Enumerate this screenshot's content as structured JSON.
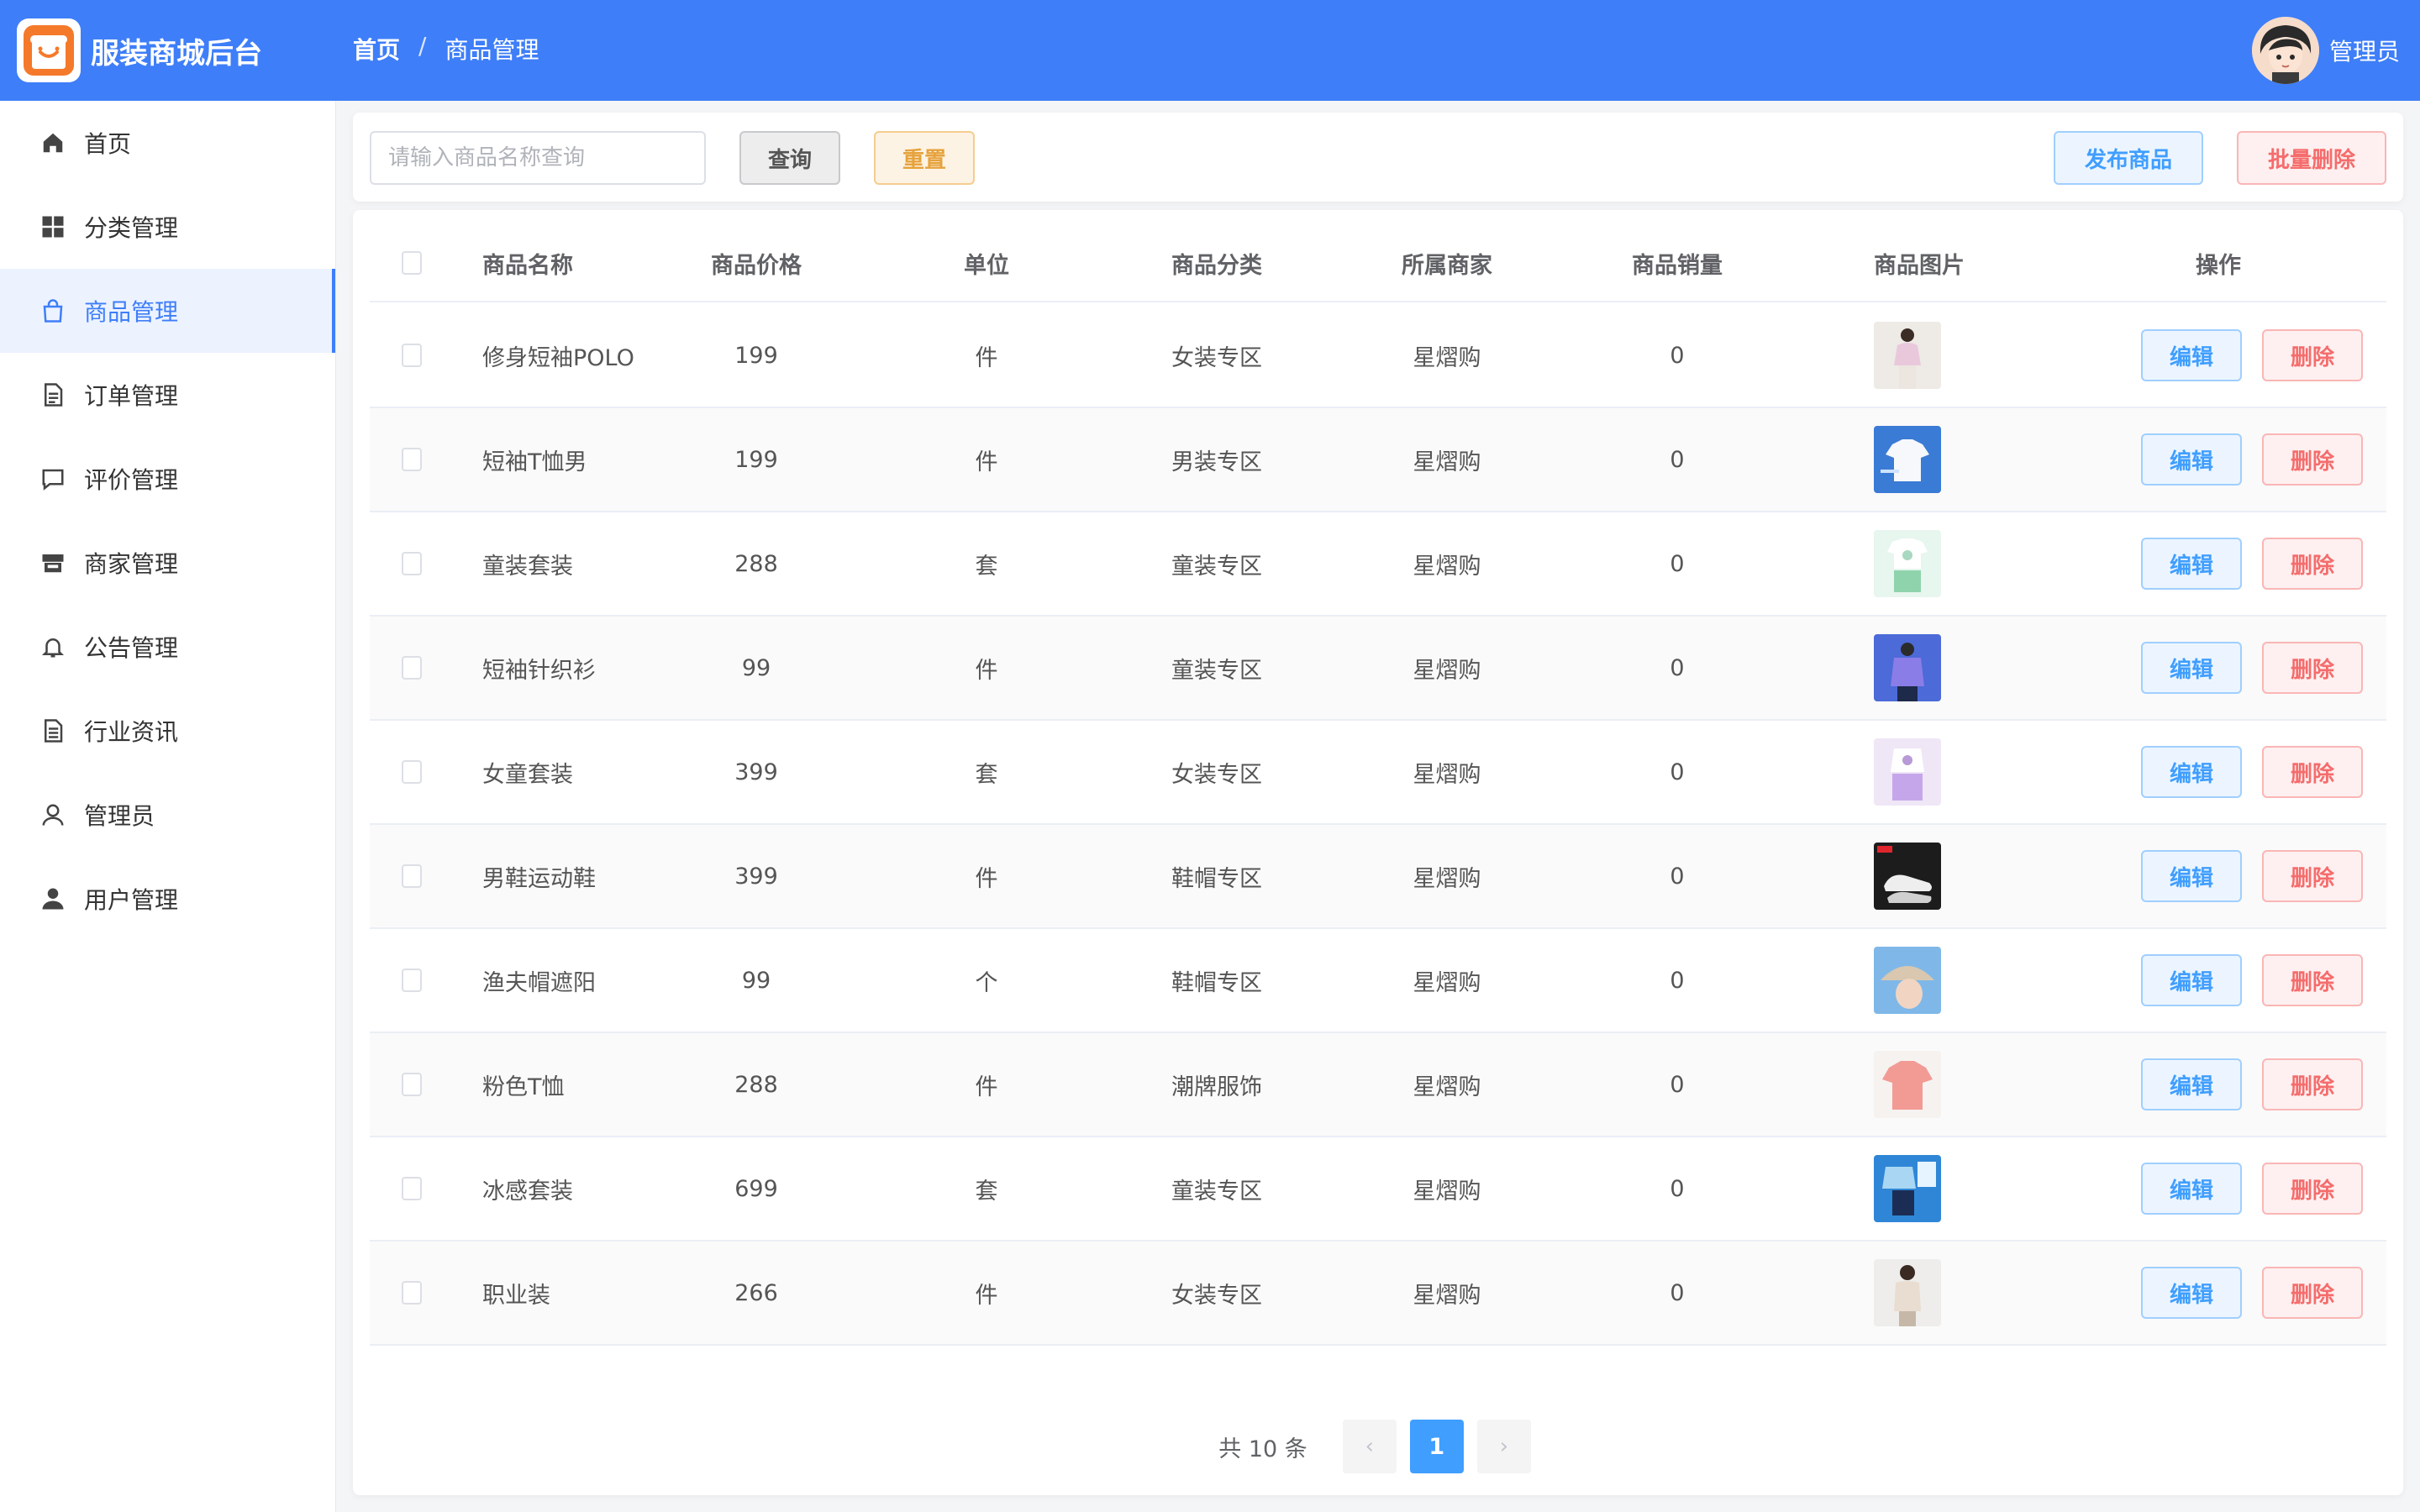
{
  "header": {
    "app_title": "服装商城后台",
    "breadcrumb": {
      "home": "首页",
      "separator": "/",
      "current": "商品管理"
    },
    "user_name": "管理员",
    "bg_color": "#3e7ef8"
  },
  "sidebar": {
    "items": [
      {
        "label": "首页",
        "icon": "home-icon",
        "active": false
      },
      {
        "label": "分类管理",
        "icon": "grid-icon",
        "active": false
      },
      {
        "label": "商品管理",
        "icon": "bag-icon",
        "active": true
      },
      {
        "label": "订单管理",
        "icon": "document-icon",
        "active": false
      },
      {
        "label": "评价管理",
        "icon": "chat-icon",
        "active": false
      },
      {
        "label": "商家管理",
        "icon": "shop-icon",
        "active": false
      },
      {
        "label": "公告管理",
        "icon": "bell-icon",
        "active": false
      },
      {
        "label": "行业资讯",
        "icon": "news-icon",
        "active": false
      },
      {
        "label": "管理员",
        "icon": "user-outline-icon",
        "active": false
      },
      {
        "label": "用户管理",
        "icon": "user-filled-icon",
        "active": false
      }
    ]
  },
  "search": {
    "placeholder": "请输入商品名称查询",
    "value": "",
    "query_label": "查询",
    "reset_label": "重置",
    "publish_label": "发布商品",
    "batch_delete_label": "批量删除"
  },
  "table": {
    "columns": [
      "商品名称",
      "商品价格",
      "单位",
      "商品分类",
      "所属商家",
      "商品销量",
      "商品图片",
      "操作"
    ],
    "edit_label": "编辑",
    "delete_label": "删除",
    "rows": [
      {
        "name": "修身短袖POLO",
        "price": "199",
        "unit": "件",
        "category": "女装专区",
        "merchant": "星熠购",
        "sales": "0",
        "thumb": "woman-polo"
      },
      {
        "name": "短袖T恤男",
        "price": "199",
        "unit": "件",
        "category": "男装专区",
        "merchant": "星熠购",
        "sales": "0",
        "thumb": "white-tee"
      },
      {
        "name": "童装套装",
        "price": "288",
        "unit": "套",
        "category": "童装专区",
        "merchant": "星熠购",
        "sales": "0",
        "thumb": "kids-set"
      },
      {
        "name": "短袖针织衫",
        "price": "99",
        "unit": "件",
        "category": "童装专区",
        "merchant": "星熠购",
        "sales": "0",
        "thumb": "purple-knit"
      },
      {
        "name": "女童套装",
        "price": "399",
        "unit": "套",
        "category": "女装专区",
        "merchant": "星熠购",
        "sales": "0",
        "thumb": "girl-set"
      },
      {
        "name": "男鞋运动鞋",
        "price": "399",
        "unit": "件",
        "category": "鞋帽专区",
        "merchant": "星熠购",
        "sales": "0",
        "thumb": "sneakers"
      },
      {
        "name": "渔夫帽遮阳",
        "price": "99",
        "unit": "个",
        "category": "鞋帽专区",
        "merchant": "星熠购",
        "sales": "0",
        "thumb": "bucket-hat"
      },
      {
        "name": "粉色T恤",
        "price": "288",
        "unit": "件",
        "category": "潮牌服饰",
        "merchant": "星熠购",
        "sales": "0",
        "thumb": "pink-tee"
      },
      {
        "name": "冰感套装",
        "price": "699",
        "unit": "套",
        "category": "童装专区",
        "merchant": "星熠购",
        "sales": "0",
        "thumb": "ice-set"
      },
      {
        "name": "职业装",
        "price": "266",
        "unit": "件",
        "category": "女装专区",
        "merchant": "星熠购",
        "sales": "0",
        "thumb": "office-wear"
      }
    ]
  },
  "pagination": {
    "total_text": "共 10 条",
    "current_page": "1",
    "prev": "‹",
    "next": "›"
  }
}
